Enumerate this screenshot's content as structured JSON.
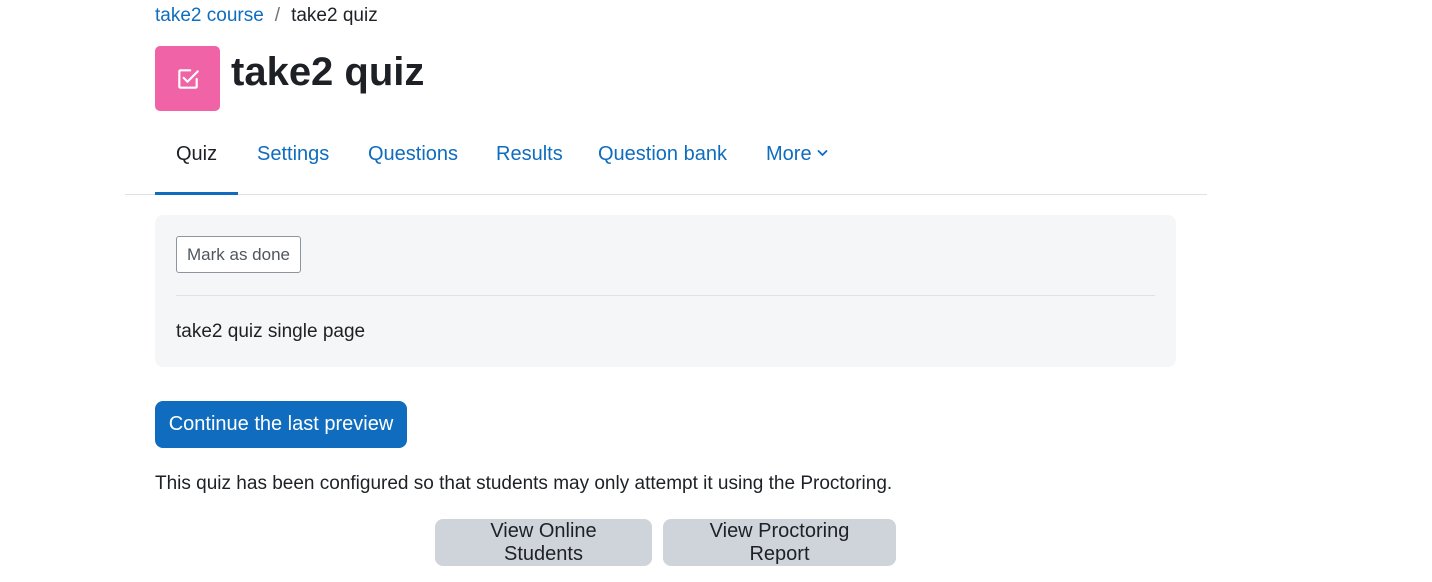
{
  "breadcrumb": {
    "course": "take2 course",
    "separator": "/",
    "current": "take2 quiz"
  },
  "header": {
    "icon": "checkbox-square-icon",
    "icon_color": "#f063a6",
    "title": "take2 quiz"
  },
  "tabs": [
    {
      "label": "Quiz",
      "active": true
    },
    {
      "label": "Settings",
      "active": false
    },
    {
      "label": "Questions",
      "active": false
    },
    {
      "label": "Results",
      "active": false
    },
    {
      "label": "Question bank",
      "active": false
    },
    {
      "label": "More",
      "active": false,
      "icon": "chevron-down-icon"
    }
  ],
  "activity_info": {
    "mark_done_label": "Mark as done",
    "description": "take2 quiz single page"
  },
  "actions": {
    "continue_preview_label": "Continue the last preview",
    "notice": "This quiz has been configured so that students may only attempt it using the Proctoring.",
    "view_online_label": "View Online Students",
    "view_report_label": "View Proctoring Report"
  },
  "colors": {
    "primary": "#0f6cbf",
    "secondary": "#ced4da",
    "info_background": "#f5f6f7"
  }
}
